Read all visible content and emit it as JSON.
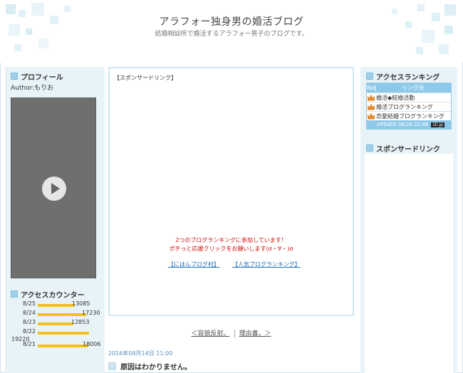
{
  "header": {
    "title": "アラフォー独身男の婚活ブログ",
    "subtitle": "結婚相談所で婚活するアラフォー男子のブログです。"
  },
  "left": {
    "profile_heading": "プロフィール",
    "author": "Author:もりお",
    "access_heading": "アクセスカウンター",
    "counter": [
      {
        "date": "8/25",
        "value": "13085",
        "bar": 0.72
      },
      {
        "date": "8/24",
        "value": "17230",
        "bar": 0.94
      },
      {
        "date": "8/23",
        "value": "12853",
        "bar": 0.7
      },
      {
        "date": "8/22",
        "value": "19220",
        "bar": 1.0
      },
      {
        "date": "8/21",
        "value": "18006",
        "bar": 0.98
      }
    ]
  },
  "center": {
    "sponsor_label": "【スポンサードリンク】",
    "promo_line1": "2つのブログランキングに参加しています！",
    "promo_line2": "ポチっと応援クリックをお願いします(σ・∀・)σ",
    "link1": "【にほんブログ村】",
    "link2": "【人気ブログランキング】",
    "prev": "＜容貌反射。",
    "next": "理由書。＞",
    "post_date": "2016年08月14日 11:00",
    "post_title": "原因はわかりません。"
  },
  "right": {
    "ranking_heading": "アクセスランキング",
    "table_no": "No",
    "table_link": "リンク元",
    "rows": [
      "婚活◆結婚活動",
      "婚活ブログランキング",
      "恋愛結婚ブログランキング"
    ],
    "update": "UPDATE 08/26 21:48",
    "badge": "i2i.jp",
    "sponsor_heading": "スポンサードリンク"
  },
  "colors": {
    "accent": "#8fc9ea",
    "promo": "#cc1111",
    "link": "#1a6fbf",
    "bar": "#f2c21b"
  }
}
